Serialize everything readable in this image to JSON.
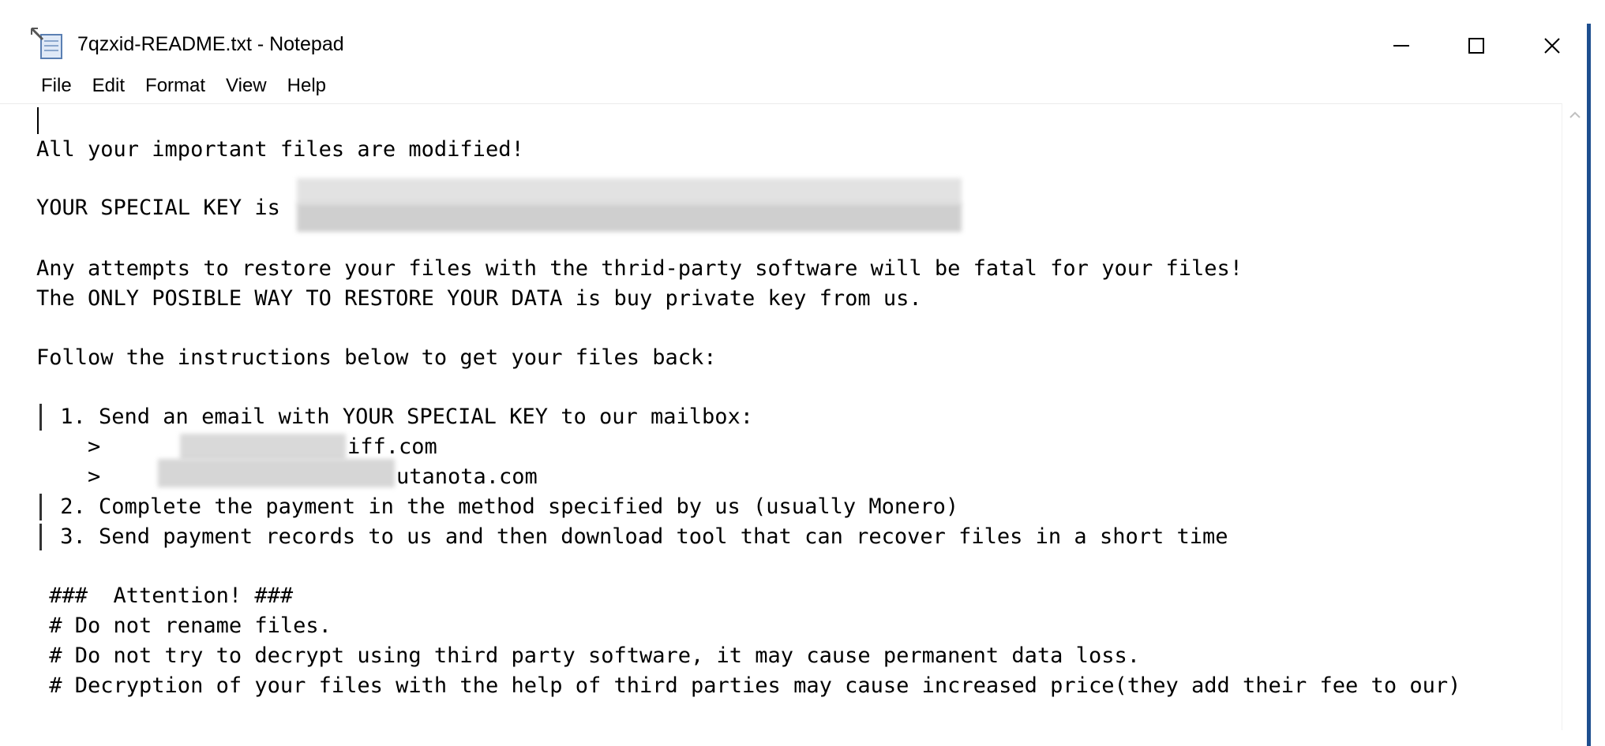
{
  "window": {
    "title": "7qzxid-README.txt - Notepad",
    "app_icon": "notepad-icon",
    "controls": {
      "minimize_icon": "minimize-icon",
      "maximize_icon": "maximize-icon",
      "close_icon": "close-icon"
    }
  },
  "menu": [
    {
      "label": "File"
    },
    {
      "label": "Edit"
    },
    {
      "label": "Format"
    },
    {
      "label": "View"
    },
    {
      "label": "Help"
    }
  ],
  "document": {
    "line1": "All your important files are modified!",
    "key_label": "YOUR SPECIAL KEY is ",
    "warning1": "Any attempts to restore your files with the thrid-party software will be fatal for your files!",
    "warning2": "The ONLY POSIBLE WAY TO RESTORE YOUR DATA is buy private key from us.",
    "follow": "Follow the instructions below to get your files back:",
    "step1": " 1. Send an email with YOUR SPECIAL KEY to our mailbox:",
    "mail1_prefix": "    >",
    "mail1_suffix": "iff.com",
    "mail2_prefix": "    >",
    "mail2_suffix": "utanota.com",
    "step2": " 2. Complete the payment in the method specified by us (usually Monero)",
    "step3": " 3. Send payment records to us and then download tool that can recover files in a short time",
    "attention": " ###  Attention! ###",
    "note1": " # Do not rename files.",
    "note2": " # Do not try to decrypt using third party software, it may cause permanent data loss.",
    "note3": " # Decryption of your files with the help of third parties may cause increased price(they add their fee to our)"
  },
  "colors": {
    "text": "#000000",
    "background": "#ffffff",
    "accent_edge": "#1e4f8f"
  }
}
